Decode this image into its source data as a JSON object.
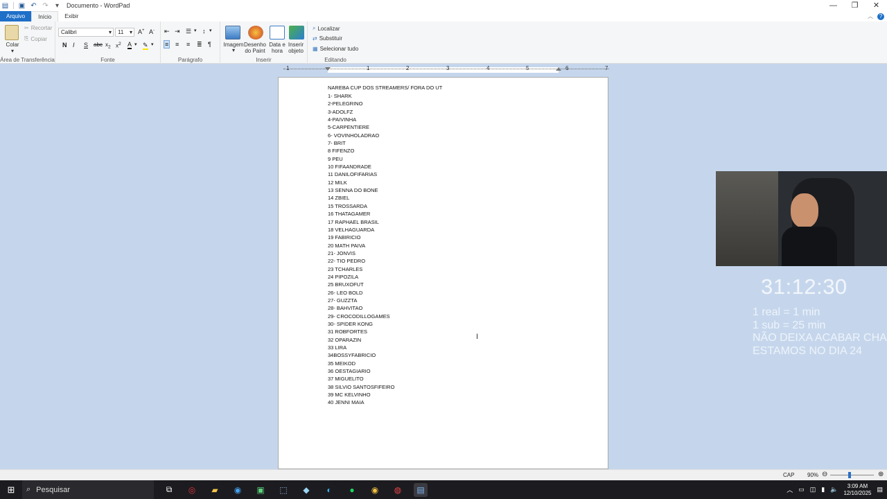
{
  "window": {
    "title": "Documento - WordPad"
  },
  "tabs": {
    "file": "Arquivo",
    "home": "Início",
    "view": "Exibir"
  },
  "clipboard": {
    "paste": "Colar",
    "cut": "Recortar",
    "copy": "Copiar",
    "label": "Área de Transferência"
  },
  "font": {
    "family": "Calibri",
    "size": "11",
    "label": "Fonte"
  },
  "paragraph": {
    "label": "Parágrafo"
  },
  "insert": {
    "image": "Imagem",
    "paint": "Desenho do Paint",
    "datetime": "Data e hora",
    "object": "Inserir objeto",
    "label": "Inserir"
  },
  "editing": {
    "find": "Localizar",
    "replace": "Substituir",
    "select_all": "Selecionar tudo",
    "label": "Editando"
  },
  "ruler": {
    "ticks": [
      "1",
      "1",
      "2",
      "3",
      "4",
      "5",
      "6",
      "7"
    ]
  },
  "document": {
    "heading": "NAREBA CUP DOS STREAMERS/  FORA DO UT",
    "lines": [
      "1- SHARK",
      "2-PELEGRINO",
      "3-ADOLFZ",
      "4-PAIVINHA",
      "5-CARPENTIERE",
      "6- VOVINHOLADRAO",
      "7- BRIT",
      "8 FIFENZO",
      "9 PEU",
      "10 FIFAANDRADE",
      "11 DANILOFIFARIAS",
      "12 MILK",
      "13 SENNA DO BONE",
      "14 ZBIEL",
      "15 TROSSARDA",
      "16 THATAGAMER",
      "17 RAPHAEL BRASIL",
      "18 VELHAGUARDA",
      "19 FABIRICIO",
      "20 MATH PAIVA",
      "21- JONVIS",
      "22- TIO PEDRO",
      "23 TCHARLES",
      "24 PIPOZILA",
      "25 BRUXOFUT",
      "26- LEO BOLD",
      "27- GUZZTA",
      "28- BAHVITAO",
      "29- CROCODILLOGAMES",
      "30- SPIDER KONG",
      "31 ROBFORTES",
      "32 OPARAZIN",
      "33 LIRA",
      "34BOSSYFABRICIO",
      "35 MEIKOD",
      "36 OESTAGIARIO",
      "37 MIGUELITO",
      "38 SILVIO SANTOSFIFEIRO",
      "39 MC KELVINHO",
      "40 JENNI MAIA"
    ]
  },
  "overlay": {
    "timer": "31:12:30",
    "line1": "1 real = 1 min",
    "line2": "1 sub = 25 min",
    "line3": "NÃO DEIXA ACABAR CHA",
    "line4": "ESTAMOS NO DIA 24"
  },
  "statusbar": {
    "caps": "CAP",
    "zoom": "90%",
    "zoom_fraction": 0.45
  },
  "taskbar": {
    "search": "Pesquisar",
    "time": "3:09 AM",
    "date": "12/10/2025"
  },
  "colors": {
    "accent": "#1e6fc8",
    "page_bg": "#c5d6ec",
    "taskbar": "#1c1c20"
  }
}
